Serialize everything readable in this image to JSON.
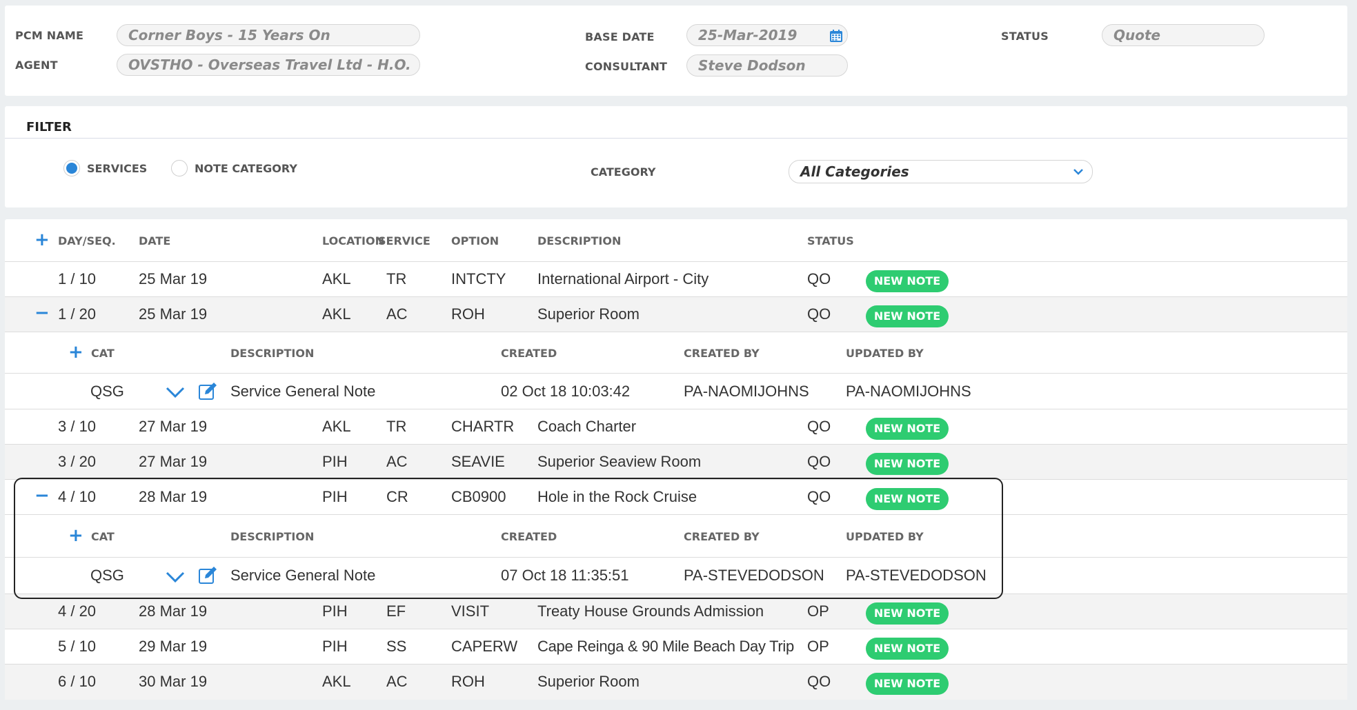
{
  "header": {
    "pcm_name_label": "PCM NAME",
    "pcm_name_value": "Corner Boys - 15 Years On",
    "agent_label": "AGENT",
    "agent_value": "OVSTHO - Overseas Travel Ltd - H.O.",
    "base_date_label": "BASE DATE",
    "base_date_value": "25-Mar-2019",
    "consultant_label": "CONSULTANT",
    "consultant_value": "Steve Dodson",
    "status_label": "STATUS",
    "status_value": "Quote"
  },
  "filter": {
    "title": "FILTER",
    "radio_services": "SERVICES",
    "radio_note_category": "NOTE CATEGORY",
    "selected": "SERVICES",
    "category_label": "CATEGORY",
    "category_value": "All Categories"
  },
  "table": {
    "columns": {
      "day_seq": "DAY/SEQ.",
      "date": "DATE",
      "location": "LOCATION",
      "service": "SERVICE",
      "option": "OPTION",
      "description": "DESCRIPTION",
      "status": "STATUS"
    },
    "note_columns": {
      "cat": "CAT",
      "description": "DESCRIPTION",
      "created": "CREATED",
      "created_by": "CREATED BY",
      "updated_by": "UPDATED BY"
    },
    "badge_label": "NEW NOTE",
    "rows": [
      {
        "day_seq": "1 / 10",
        "date": "25 Mar 19",
        "location": "AKL",
        "service": "TR",
        "option": "INTCTY",
        "description": "International Airport - City",
        "status": "QO"
      },
      {
        "day_seq": "1 / 20",
        "date": "25 Mar 19",
        "location": "AKL",
        "service": "AC",
        "option": "ROH",
        "description": "Superior Room",
        "status": "QO"
      },
      {
        "day_seq": "3 / 10",
        "date": "27 Mar 19",
        "location": "AKL",
        "service": "TR",
        "option": "CHARTR",
        "description": "Coach Charter",
        "status": "QO"
      },
      {
        "day_seq": "3 / 20",
        "date": "27 Mar 19",
        "location": "PIH",
        "service": "AC",
        "option": "SEAVIE",
        "description": "Superior Seaview Room",
        "status": "QO"
      },
      {
        "day_seq": "4 / 10",
        "date": "28 Mar 19",
        "location": "PIH",
        "service": "CR",
        "option": "CB0900",
        "description": "Hole in the Rock Cruise",
        "status": "QO"
      },
      {
        "day_seq": "4 / 20",
        "date": "28 Mar 19",
        "location": "PIH",
        "service": "EF",
        "option": "VISIT",
        "description": "Treaty House Grounds Admission",
        "status": "OP"
      },
      {
        "day_seq": "5 / 10",
        "date": "29 Mar 19",
        "location": "PIH",
        "service": "SS",
        "option": "CAPERW",
        "description": "Cape Reinga & 90 Mile Beach Day Trip",
        "status": "OP"
      },
      {
        "day_seq": "6 / 10",
        "date": "30 Mar 19",
        "location": "AKL",
        "service": "AC",
        "option": "ROH",
        "description": "Superior Room",
        "status": "QO"
      }
    ],
    "notes": [
      {
        "cat": "QSG",
        "description": "Service General Note",
        "created": "02 Oct 18 10:03:42",
        "created_by": "PA-NAOMIJOHNS",
        "updated_by": "PA-NAOMIJOHNS"
      },
      {
        "cat": "QSG",
        "description": "Service General Note",
        "created": "07 Oct 18 11:35:51",
        "created_by": "PA-STEVEDODSON",
        "updated_by": "PA-STEVEDODSON"
      }
    ]
  },
  "colors": {
    "accent": "#2a86d8",
    "badge": "#2ecc71"
  }
}
